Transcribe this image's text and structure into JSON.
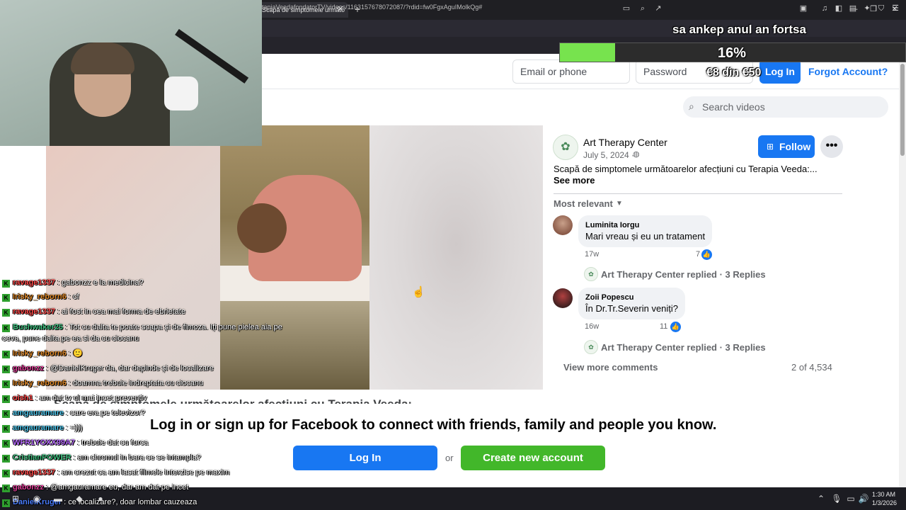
{
  "browser": {
    "tab_title": "Scapă de simptomele următo",
    "tab_close": "✕",
    "new_tab": "+",
    "url": "tapiaVeedafondatorTV/videos/1163157678072087/?rdid=fw0FgxAguIMolkQg#",
    "window_controls": [
      "—",
      "❐",
      "✕"
    ]
  },
  "overlay": {
    "title": "sa ankep anul an fortsa",
    "progress_percent": 16,
    "progress_label": "16%",
    "donation": "€8 din €50"
  },
  "header": {
    "email_placeholder": "Email or phone",
    "password_placeholder": "Password",
    "login_label": "Log In",
    "forgot_label": "Forgot Account?",
    "search_placeholder": "Search videos"
  },
  "post": {
    "page_name": "Art Therapy Center",
    "date": "July 5, 2024 ·",
    "follow_label": "Follow",
    "more_label": "•••",
    "text": "Scapă de simptomele următoarelor afecțiuni cu Terapia Veeda:...",
    "see_more": "See more",
    "sort_label": "Most relevant",
    "video_title": "Scapă de simptomele următoarelor afecțiuni cu Terapia Veeda:"
  },
  "comments": [
    {
      "author": "Luminita Iorgu",
      "text": "Mari vreau și eu un tratament",
      "time": "17w",
      "likes": "7",
      "replies": "Art Therapy Center replied · 3 Replies"
    },
    {
      "author": "Zoii Popescu",
      "text": "În Dr.Tr.Severin veniți?",
      "time": "16w",
      "likes": "11",
      "replies": "Art Therapy Center replied · 3 Replies"
    }
  ],
  "comments_footer": {
    "view_more": "View more comments",
    "count": "2 of 4,534"
  },
  "banner": {
    "text": "Log in or sign up for Facebook to connect with friends, family and people you know.",
    "login": "Log In",
    "or": "or",
    "create": "Create new account"
  },
  "chat": [
    {
      "user": "ravage1337",
      "msg": ": gabonzz e la medicina?",
      "color": "#ff4a4a"
    },
    {
      "user": "Irisky_reborn6",
      "msg": ": cf",
      "color": "#e08a2b"
    },
    {
      "user": "ravage1337",
      "msg": ": ai fost in cea mai forma de ebrietate",
      "color": "#ff4a4a"
    },
    {
      "user": "Bushwaker25",
      "msg": ": Tot cu dalta te poate scapa și de fimoza. Iți pune pielea aia pe",
      "color": "#3fbf7f"
    },
    {
      "user": "",
      "msg": "ceva, pune dalta pe ea si da cu ciocanu",
      "color": "#ffffff"
    },
    {
      "user": "Irisky_reborn6",
      "msg": ": 🙂",
      "color": "#e08a2b"
    },
    {
      "user": "gabonzz",
      "msg": ": @DanielKruger da, dar depinde și de localizare",
      "color": "#e0409a"
    },
    {
      "user": "Irisky_reborn6",
      "msg": ": doamna trebuie indreptata cu ciocanu",
      "color": "#e08a2b"
    },
    {
      "user": "oish1",
      "msg": ": am dat tv ul mai incet preventiv",
      "color": "#ff4a4a"
    },
    {
      "user": "amgauramare",
      "msg": ": care era pe televizor?",
      "color": "#4fc3e8"
    },
    {
      "user": "amgauramare",
      "msg": ": =)))",
      "color": "#4fc3e8"
    },
    {
      "user": "WFR1YOXX99A7",
      "msg": ": trebuie dat cu furca",
      "color": "#b86bff"
    },
    {
      "user": "CristianPOWER",
      "msg": ": am chromul in bara ce se intampla?",
      "color": "#3fbf7f"
    },
    {
      "user": "ravage1337",
      "msg": ": am crezut ca am lasat filmele interzise pe maxim",
      "color": "#ff4a4a"
    },
    {
      "user": "gabonzz",
      "msg": ": @amgauramare eu, dar am dat pe incet",
      "color": "#e0409a"
    },
    {
      "user": "DanielKruger",
      "msg": ": ce localizare?, doar lombar cauzeaza",
      "color": "#4a7dff"
    }
  ],
  "chat_badge": "K",
  "taskbar": {
    "time": "1:30 AM",
    "date": "1/3/2026"
  },
  "colors": {
    "fb_blue": "#1877f2",
    "fb_green": "#42b72a",
    "progress_green": "#77e34e"
  }
}
